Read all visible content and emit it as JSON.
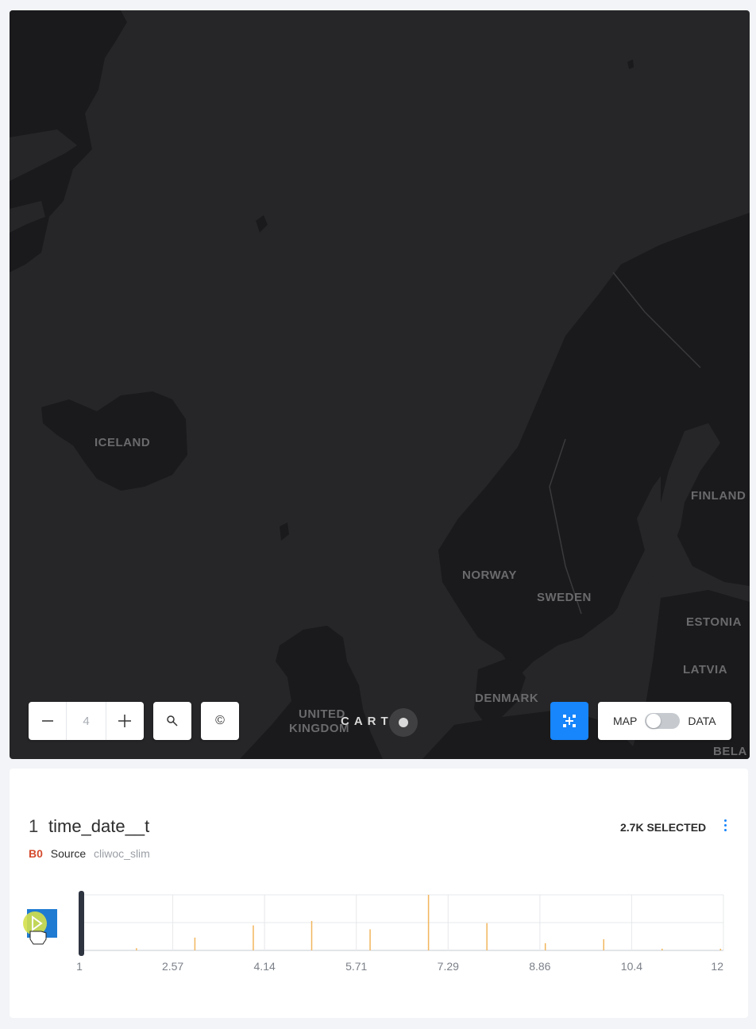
{
  "map": {
    "labels": {
      "iceland": "ICELAND",
      "norway": "NORWAY",
      "sweden": "SWEDEN",
      "finland": "FINLAND",
      "estonia": "ESTONIA",
      "latvia": "LATVIA",
      "denmark": "DENMARK",
      "uk_line1": "UNITED",
      "uk_line2": "KINGDOM",
      "belarus": "BELA"
    },
    "zoom_level": "4",
    "copyright_symbol": "©",
    "brand": "CART",
    "toggle": {
      "left": "MAP",
      "right": "DATA",
      "on": false
    },
    "colors": {
      "land": "#1a1a1c",
      "water": "#262628",
      "accent": "#1785fb"
    }
  },
  "widget": {
    "number": "1",
    "title": "time_date__t",
    "selected": "2.7K SELECTED",
    "source_badge": "B0",
    "source_label": "Source",
    "source_name": "cliwoc_slim",
    "bar_color": "#f2b65d"
  },
  "chart_data": {
    "type": "bar",
    "title": "",
    "xlabel": "",
    "ylabel": "",
    "x_ticks": [
      "1",
      "2.57",
      "4.14",
      "5.71",
      "7.29",
      "8.86",
      "10.4",
      "12"
    ],
    "xlim": [
      1,
      12
    ],
    "ylim": [
      0,
      1
    ],
    "grid": true,
    "x": [
      1.95,
      2.95,
      3.95,
      4.95,
      5.95,
      6.95,
      7.95,
      8.95,
      9.95,
      10.95,
      11.95
    ],
    "values": [
      0.04,
      0.23,
      0.45,
      0.53,
      0.38,
      1.0,
      0.49,
      0.13,
      0.2,
      0.03,
      0.03
    ]
  }
}
